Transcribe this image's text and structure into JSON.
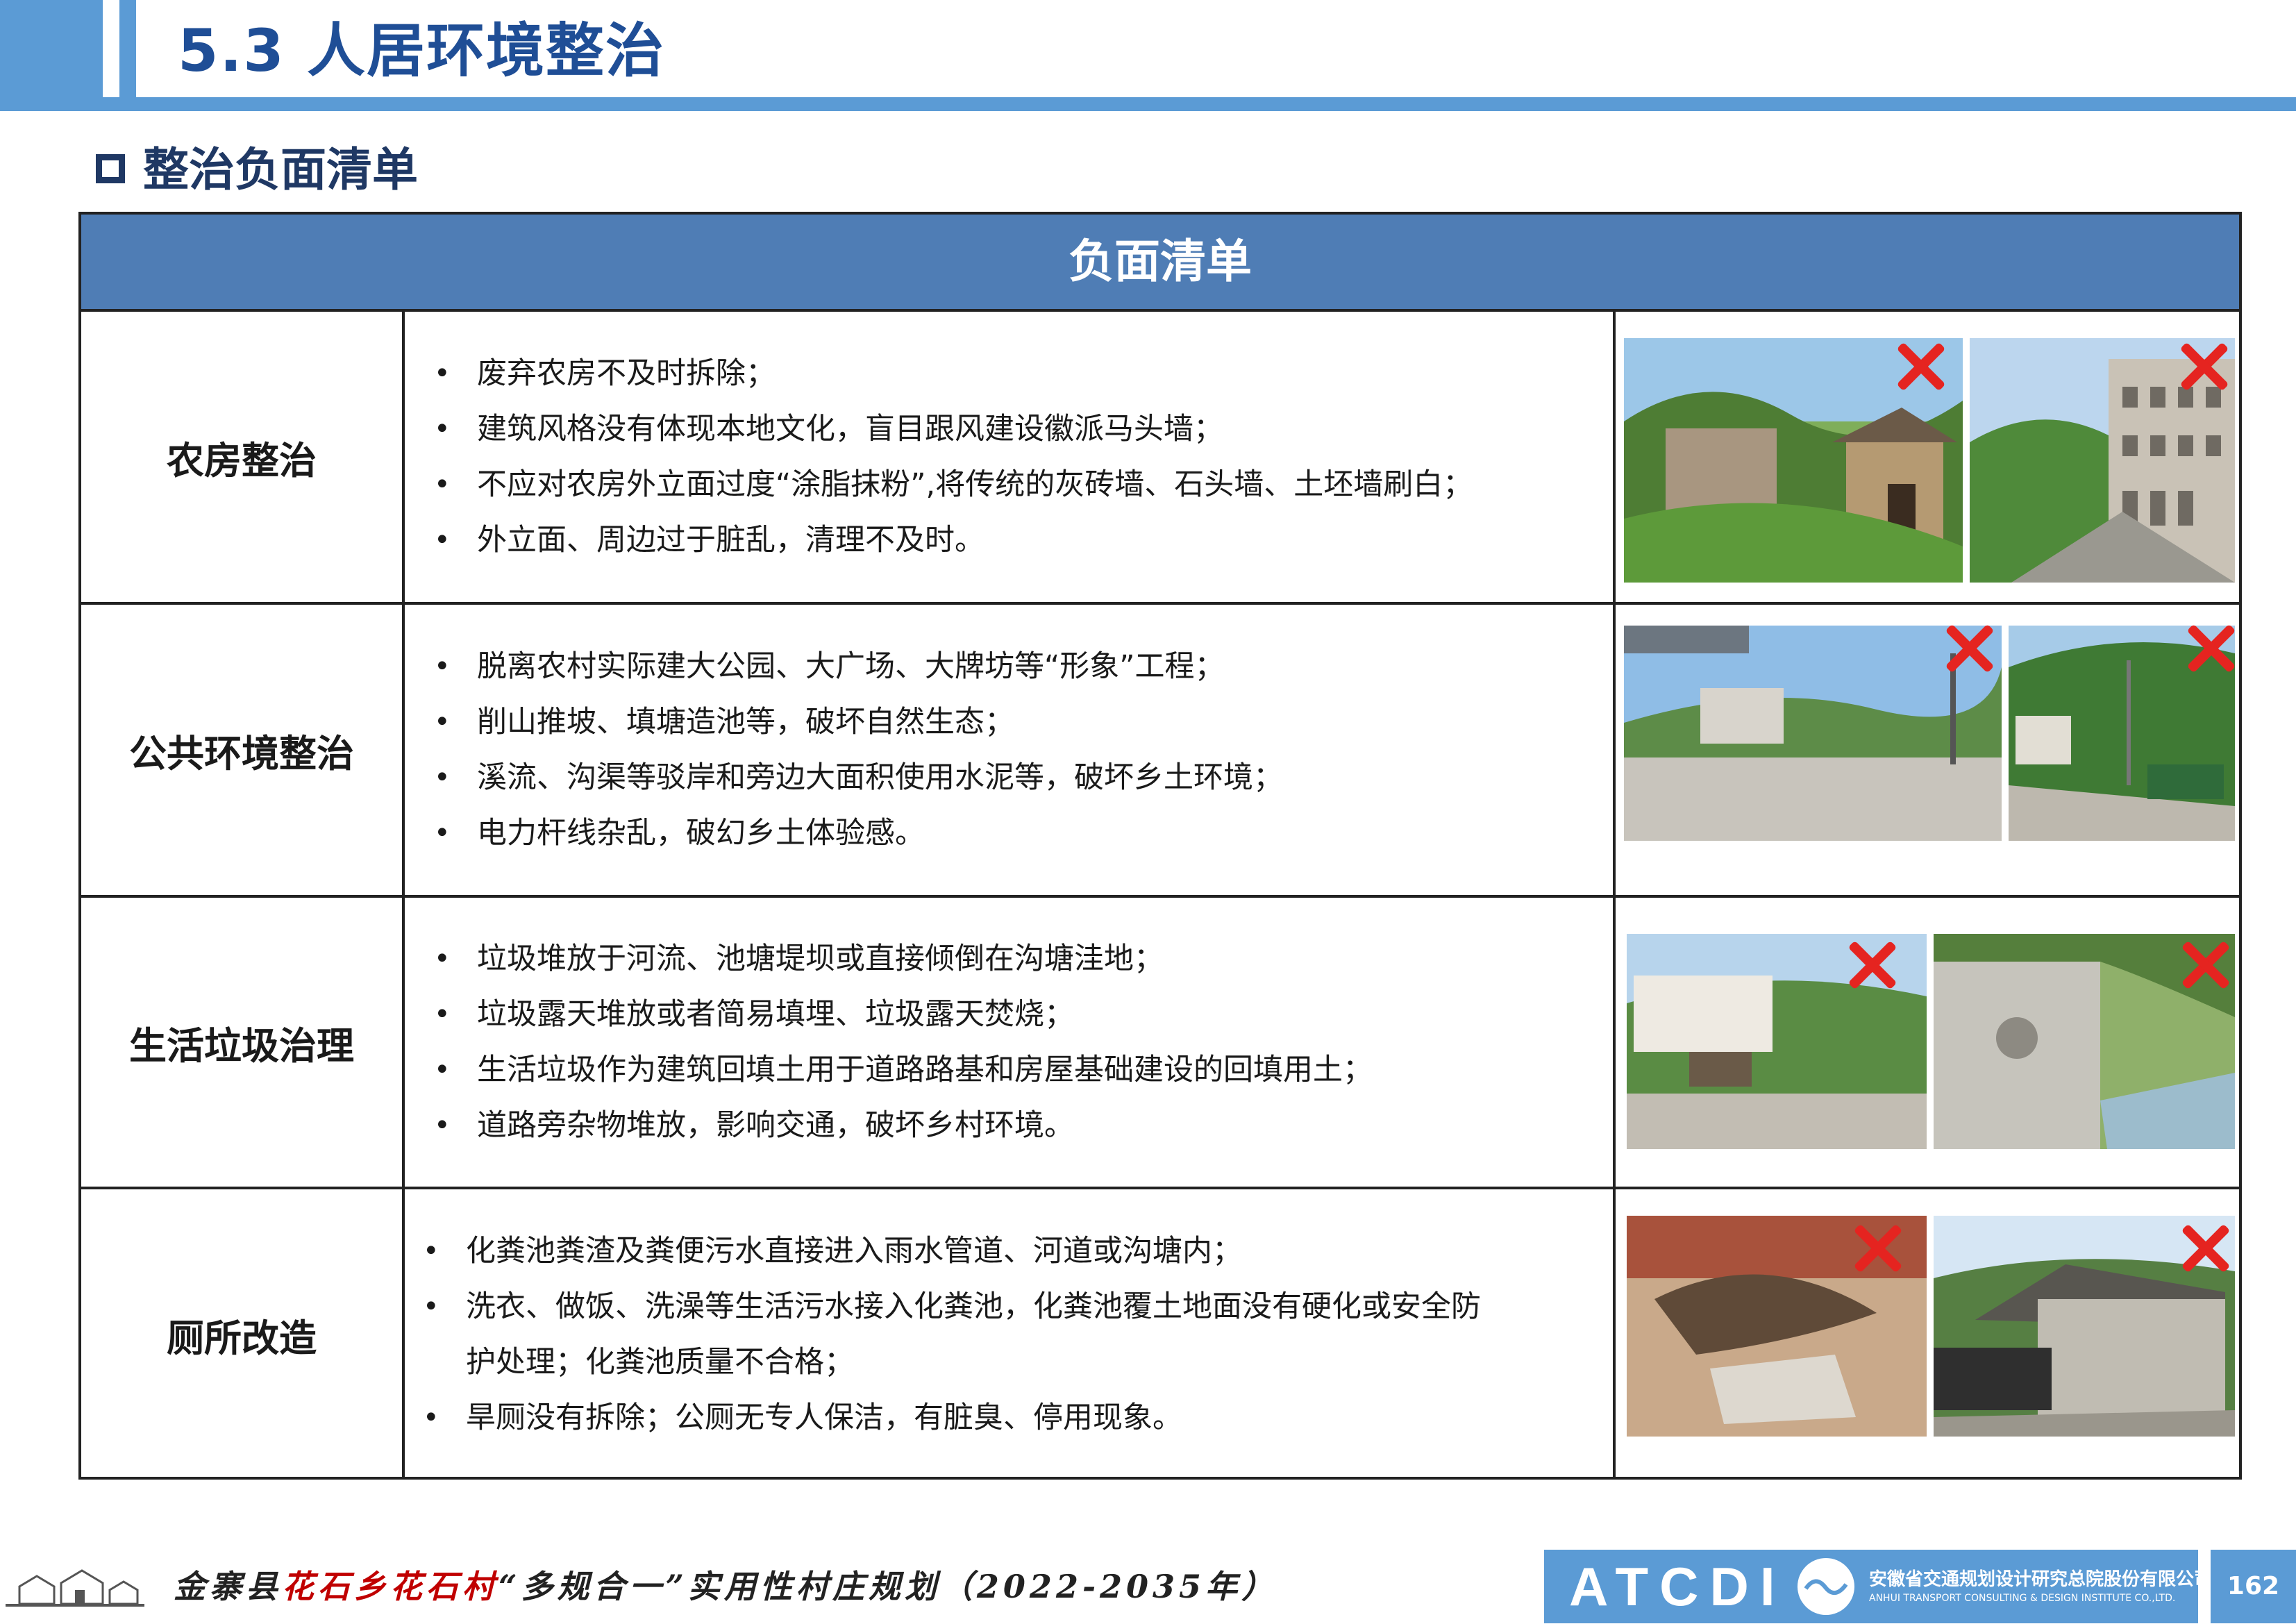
{
  "header": {
    "title": "5.3 人居环境整治"
  },
  "section": {
    "title": "整治负面清单"
  },
  "table": {
    "header": "负面清单",
    "rows": [
      {
        "category": "农房整治",
        "items": [
          "废弃农房不及时拆除；",
          "建筑风格没有体现本地文化，盲目跟风建设徽派马头墙；",
          "不应对农房外立面过度“涂脂抹粉”,将传统的灰砖墙、石头墙、土坯墙刷白；",
          "外立面、周边过于脏乱，清理不及时。"
        ]
      },
      {
        "category": "公共环境整治",
        "items": [
          "脱离农村实际建大公园、大广场、大牌坊等“形象”工程；",
          "削山推坡、填塘造池等，破坏自然生态；",
          "溪流、沟渠等驳岸和旁边大面积使用水泥等，破坏乡土环境；",
          "电力杆线杂乱，破幻乡土体验感。"
        ]
      },
      {
        "category": "生活垃圾治理",
        "items": [
          "垃圾堆放于河流、池塘堤坝或直接倾倒在沟塘洼地；",
          "垃圾露天堆放或者简易填埋、垃圾露天焚烧；",
          " 生活垃圾作为建筑回填土用于道路路基和房屋基础建设的回填用土；",
          " 道路旁杂物堆放，影响交通，破坏乡村环境。"
        ]
      },
      {
        "category": "厕所改造",
        "items": [
          "化粪池粪渣及粪便污水直接进入雨水管道、河道或沟塘内；",
          "洗衣、做饭、洗澡等生活污水接入化粪池，化粪池覆土地面没有硬化或安全防",
          "护处理；化粪池质量不合格；",
          "旱厕没有拆除；公厕无专人保洁，有脏臭、停用现象。"
        ]
      }
    ]
  },
  "footer": {
    "title_part1": "金寨县",
    "title_part2": "花石乡花石村",
    "title_part3": "“多规合一”实用性村庄规划",
    "title_part4": "（2022-2035年）",
    "logo_abbr": "ATCDI",
    "logo_cn": "安徽省交通规划设计研究总院股份有限公司",
    "logo_en": "ANHUI TRANSPORT CONSULTING & DESIGN INSTITUTE CO.,LTD.",
    "page_number": "162"
  },
  "colors": {
    "accent": "#5b9bd5",
    "table_header": "#4f7db5",
    "cross": "#e52420"
  }
}
